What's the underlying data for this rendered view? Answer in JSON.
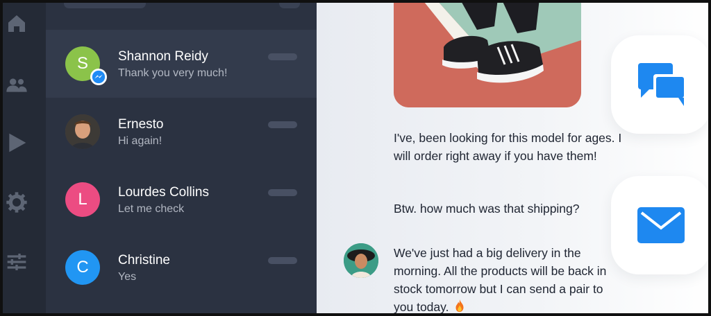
{
  "colors": {
    "rail_bg": "#242a36",
    "list_bg": "#2b3241",
    "active_row_bg": "#333b4c",
    "accent_blue": "#1e88f0",
    "messenger_blue": "#1f8bf5"
  },
  "rail": {
    "icons": [
      "home-icon",
      "people-icon",
      "play-icon",
      "gear-icon",
      "sliders-icon"
    ]
  },
  "conversations": [
    {
      "name": "Shannon Reidy",
      "preview": "Thank you very much!",
      "initial": "S",
      "avatar_color": "#8bc34a",
      "active": true,
      "badge": "messenger-icon"
    },
    {
      "name": "Ernesto",
      "preview": "Hi again!",
      "initial": "",
      "avatar_color": "#5b4a3e",
      "active": false
    },
    {
      "name": "Lourdes Collins",
      "preview": "Let me check",
      "initial": "L",
      "avatar_color": "#ec4c82",
      "active": false
    },
    {
      "name": "Christine",
      "preview": "Yes",
      "initial": "C",
      "avatar_color": "#2196f3",
      "active": false
    }
  ],
  "chat": {
    "messages": [
      {
        "from": "contact",
        "text": "I've, been looking for this model for ages. I will order right away if you have them!"
      },
      {
        "from": "contact",
        "text": "Btw. how much was that shipping?"
      },
      {
        "from": "agent",
        "text": "We've just had a big delivery in the morning. All the products will be back in stock tomorrow but I can send a pair to you today."
      }
    ],
    "emoji": "fire-emoji"
  },
  "fabs": {
    "chat_icon": "chat-bubbles-icon",
    "mail_icon": "mail-icon"
  }
}
